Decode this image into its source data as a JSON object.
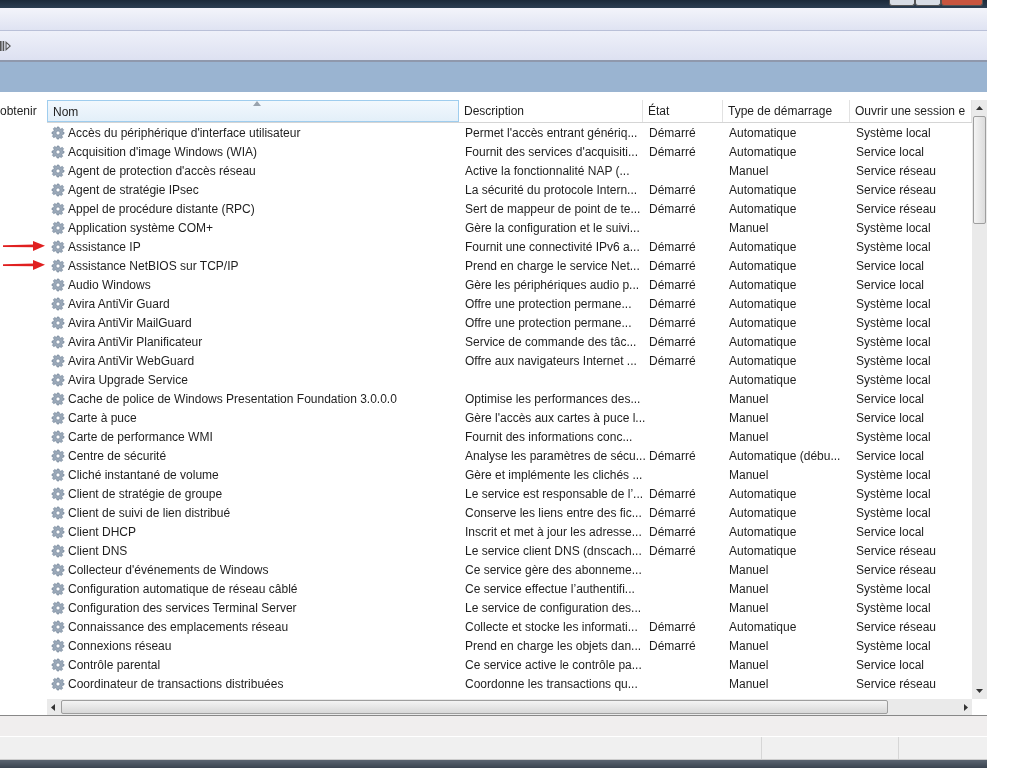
{
  "left_pane": {
    "label": "obtenir"
  },
  "table": {
    "columns": [
      {
        "label": "Nom",
        "sorted": true
      },
      {
        "label": "Description",
        "sorted": false
      },
      {
        "label": "État",
        "sorted": false
      },
      {
        "label": "Type de démarrage",
        "sorted": false
      },
      {
        "label": "Ouvrir une session e",
        "sorted": false
      }
    ],
    "rows": [
      {
        "name": "Accès du périphérique d'interface utilisateur",
        "description": "Permet l'accès entrant génériq...",
        "status": "Démarré",
        "startup": "Automatique",
        "logon": "Système local",
        "arrow": false
      },
      {
        "name": "Acquisition d'image Windows (WIA)",
        "description": "Fournit des services d'acquisiti...",
        "status": "Démarré",
        "startup": "Automatique",
        "logon": "Service local",
        "arrow": false
      },
      {
        "name": "Agent de protection d'accès réseau",
        "description": "Active la fonctionnalité NAP (...",
        "startup": "Manuel",
        "logon": "Service réseau",
        "arrow": false
      },
      {
        "name": "Agent de stratégie IPsec",
        "description": "La sécurité du protocole Intern...",
        "status": "Démarré",
        "startup": "Automatique",
        "logon": "Service réseau",
        "arrow": false
      },
      {
        "name": "Appel de procédure distante (RPC)",
        "description": "Sert de mappeur de point de te...",
        "status": "Démarré",
        "startup": "Automatique",
        "logon": "Service réseau",
        "arrow": false
      },
      {
        "name": "Application système COM+",
        "description": "Gère la configuration et le suivi...",
        "startup": "Manuel",
        "logon": "Système local",
        "arrow": false
      },
      {
        "name": "Assistance IP",
        "description": "Fournit une connectivité IPv6 a...",
        "status": "Démarré",
        "startup": "Automatique",
        "logon": "Système local",
        "arrow": true
      },
      {
        "name": "Assistance NetBIOS sur TCP/IP",
        "description": "Prend en charge le service Net...",
        "status": "Démarré",
        "startup": "Automatique",
        "logon": "Service local",
        "arrow": true
      },
      {
        "name": "Audio Windows",
        "description": "Gère les périphériques audio p...",
        "status": "Démarré",
        "startup": "Automatique",
        "logon": "Service local",
        "arrow": false
      },
      {
        "name": "Avira AntiVir Guard",
        "description": "Offre une protection permane...",
        "status": "Démarré",
        "startup": "Automatique",
        "logon": "Système local",
        "arrow": false
      },
      {
        "name": "Avira AntiVir MailGuard",
        "description": "Offre une protection permane...",
        "status": "Démarré",
        "startup": "Automatique",
        "logon": "Système local",
        "arrow": false
      },
      {
        "name": "Avira AntiVir Planificateur",
        "description": "Service de commande des tâc...",
        "status": "Démarré",
        "startup": "Automatique",
        "logon": "Système local",
        "arrow": false
      },
      {
        "name": "Avira AntiVir WebGuard",
        "description": "Offre aux navigateurs Internet ...",
        "status": "Démarré",
        "startup": "Automatique",
        "logon": "Système local",
        "arrow": false
      },
      {
        "name": "Avira Upgrade Service",
        "startup": "Automatique",
        "logon": "Système local",
        "arrow": false
      },
      {
        "name": "Cache de police de Windows Presentation Foundation 3.0.0.0",
        "description": "Optimise les performances des...",
        "startup": "Manuel",
        "logon": "Service local",
        "arrow": false
      },
      {
        "name": "Carte à puce",
        "description": "Gère l'accès aux cartes à puce l...",
        "startup": "Manuel",
        "logon": "Service local",
        "arrow": false
      },
      {
        "name": "Carte de performance WMI",
        "description": "Fournit des informations conc...",
        "startup": "Manuel",
        "logon": "Système local",
        "arrow": false
      },
      {
        "name": "Centre de sécurité",
        "description": "Analyse les paramètres de sécu...",
        "status": "Démarré",
        "startup": "Automatique (débu...",
        "logon": "Service local",
        "arrow": false
      },
      {
        "name": "Cliché instantané de volume",
        "description": "Gère et implémente les clichés ...",
        "startup": "Manuel",
        "logon": "Système local",
        "arrow": false
      },
      {
        "name": "Client de stratégie de groupe",
        "description": "Le service est responsable de l’...",
        "status": "Démarré",
        "startup": "Automatique",
        "logon": "Système local",
        "arrow": false
      },
      {
        "name": "Client de suivi de lien distribué",
        "description": "Conserve les liens entre des fic...",
        "status": "Démarré",
        "startup": "Automatique",
        "logon": "Système local",
        "arrow": false
      },
      {
        "name": "Client DHCP",
        "description": "Inscrit et met à jour les adresse...",
        "status": "Démarré",
        "startup": "Automatique",
        "logon": "Service local",
        "arrow": false
      },
      {
        "name": "Client DNS",
        "description": "Le service client DNS (dnscach...",
        "status": "Démarré",
        "startup": "Automatique",
        "logon": "Service réseau",
        "arrow": false
      },
      {
        "name": "Collecteur d'événements de Windows",
        "description": "Ce service gère des abonneme...",
        "startup": "Manuel",
        "logon": "Service réseau",
        "arrow": false
      },
      {
        "name": "Configuration automatique de réseau câblé",
        "description": "Ce service effectue l’authentifi...",
        "startup": "Manuel",
        "logon": "Système local",
        "arrow": false
      },
      {
        "name": "Configuration des services Terminal Server",
        "description": "Le service de configuration des...",
        "startup": "Manuel",
        "logon": "Système local",
        "arrow": false
      },
      {
        "name": "Connaissance des emplacements réseau",
        "description": "Collecte et stocke les informati...",
        "status": "Démarré",
        "startup": "Automatique",
        "logon": "Service réseau",
        "arrow": false
      },
      {
        "name": "Connexions réseau",
        "description": "Prend en charge les objets dan...",
        "status": "Démarré",
        "startup": "Manuel",
        "logon": "Système local",
        "arrow": false
      },
      {
        "name": "Contrôle parental",
        "description": "Ce service active le contrôle pa...",
        "startup": "Manuel",
        "logon": "Service local",
        "arrow": false
      },
      {
        "name": "Coordinateur de transactions distribuées",
        "description": "Coordonne les transactions qu...",
        "startup": "Manuel",
        "logon": "Service réseau",
        "arrow": false
      }
    ]
  }
}
